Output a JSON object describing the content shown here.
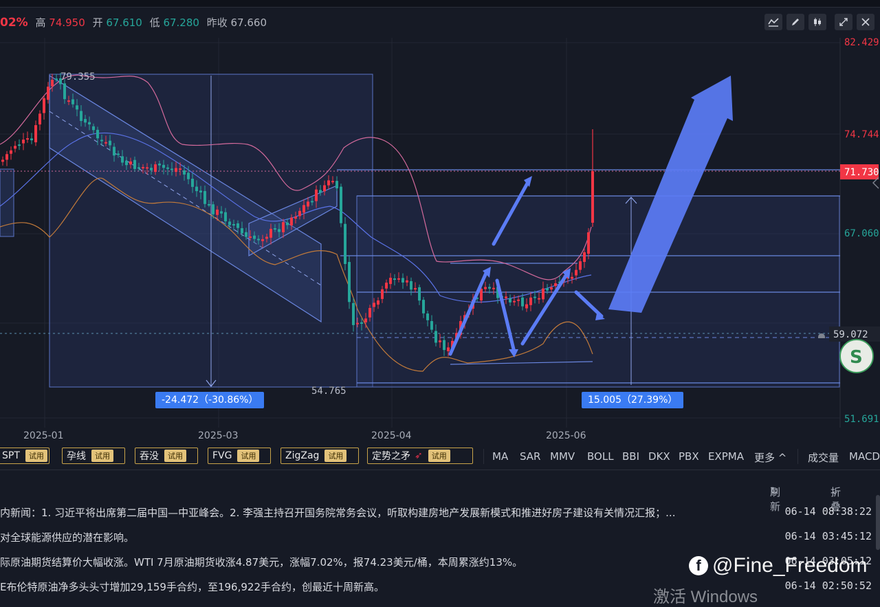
{
  "quote": {
    "change_pct": "02%",
    "high_label": "高",
    "high": "74.950",
    "open_label": "开",
    "open": "67.610",
    "low_label": "低",
    "low": "67.280",
    "prev_label": "昨收",
    "prev": "67.660"
  },
  "toolbar_icons": [
    "indicator-icon",
    "draw-icon",
    "candle-style-icon",
    "expand-icon",
    "close-icon"
  ],
  "chart": {
    "price_axis": {
      "top": "82.429",
      "mid1": "74.744",
      "current": "71.730",
      "mid2": "67.060",
      "alert": "59.072",
      "bottom": "51.691"
    },
    "date_labels": [
      "2025-01",
      "2025-03",
      "2025-04",
      "2025-06"
    ],
    "peak_label": "79.355",
    "trough_label": "54.765",
    "measure_down": "-24.472（-30.86%）",
    "measure_up": "15.005（27.39%）",
    "colors": {
      "up": "#f23645",
      "down": "#26a69a",
      "tag": "#3a7bf2",
      "arrow": "#5b7cf5",
      "boll_upper": "#d46a9c",
      "boll_lower": "#c27a3a",
      "boll_mid": "#5a72e6"
    }
  },
  "chart_data": {
    "type": "candlestick",
    "x": [
      "2025-01",
      "2025-03",
      "2025-04",
      "2025-06"
    ],
    "ylim": [
      51.691,
      82.429
    ],
    "annotations": [
      "79.355",
      "54.765",
      "-24.472（-30.86%）",
      "15.005（27.39%）"
    ],
    "last": 71.73
  },
  "indicator_bar": {
    "pills": [
      {
        "label": "SPT",
        "trial": "试用"
      },
      {
        "label": "孕线",
        "trial": "试用"
      },
      {
        "label": "吞没",
        "trial": "试用"
      },
      {
        "label": "FVG",
        "trial": "试用"
      },
      {
        "label": "ZigZag",
        "trial": "试用"
      },
      {
        "label": "定势之矛",
        "trial": "试用"
      }
    ],
    "indicators": [
      "MA",
      "SAR",
      "MMV",
      "BOLL",
      "BBI",
      "DKX",
      "PBX",
      "EXPMA",
      "更多 ^",
      "成交量",
      "MACD"
    ]
  },
  "news": {
    "refresh": "刷新",
    "collapse": "折叠",
    "items": [
      {
        "text": "内新闻：1. 习近平将出席第二届中国—中亚峰会。2. 李强主持召开国务院常务会议，听取构建房地产发展新模式和推进好房子建设有关情况汇报；...",
        "time": "06-14 08:38:22"
      },
      {
        "text": "对全球能源供应的潜在影响。",
        "time": "06-14 03:45:12"
      },
      {
        "text": "际原油期货结算价大幅收涨。WTI 7月原油期货收涨4.87美元，涨幅7.02%，报74.23美元/桶，本周累涨约13%。",
        "time": "06-14 03:05:12"
      },
      {
        "text": "E布伦特原油净多头头寸增加29,159手合约，至196,922手合约，创最近十周新高。",
        "time": "06-14 02:50:52"
      }
    ]
  },
  "watermark": {
    "handle": "@Fine_Freedom",
    "windows": "激活 Windows"
  }
}
